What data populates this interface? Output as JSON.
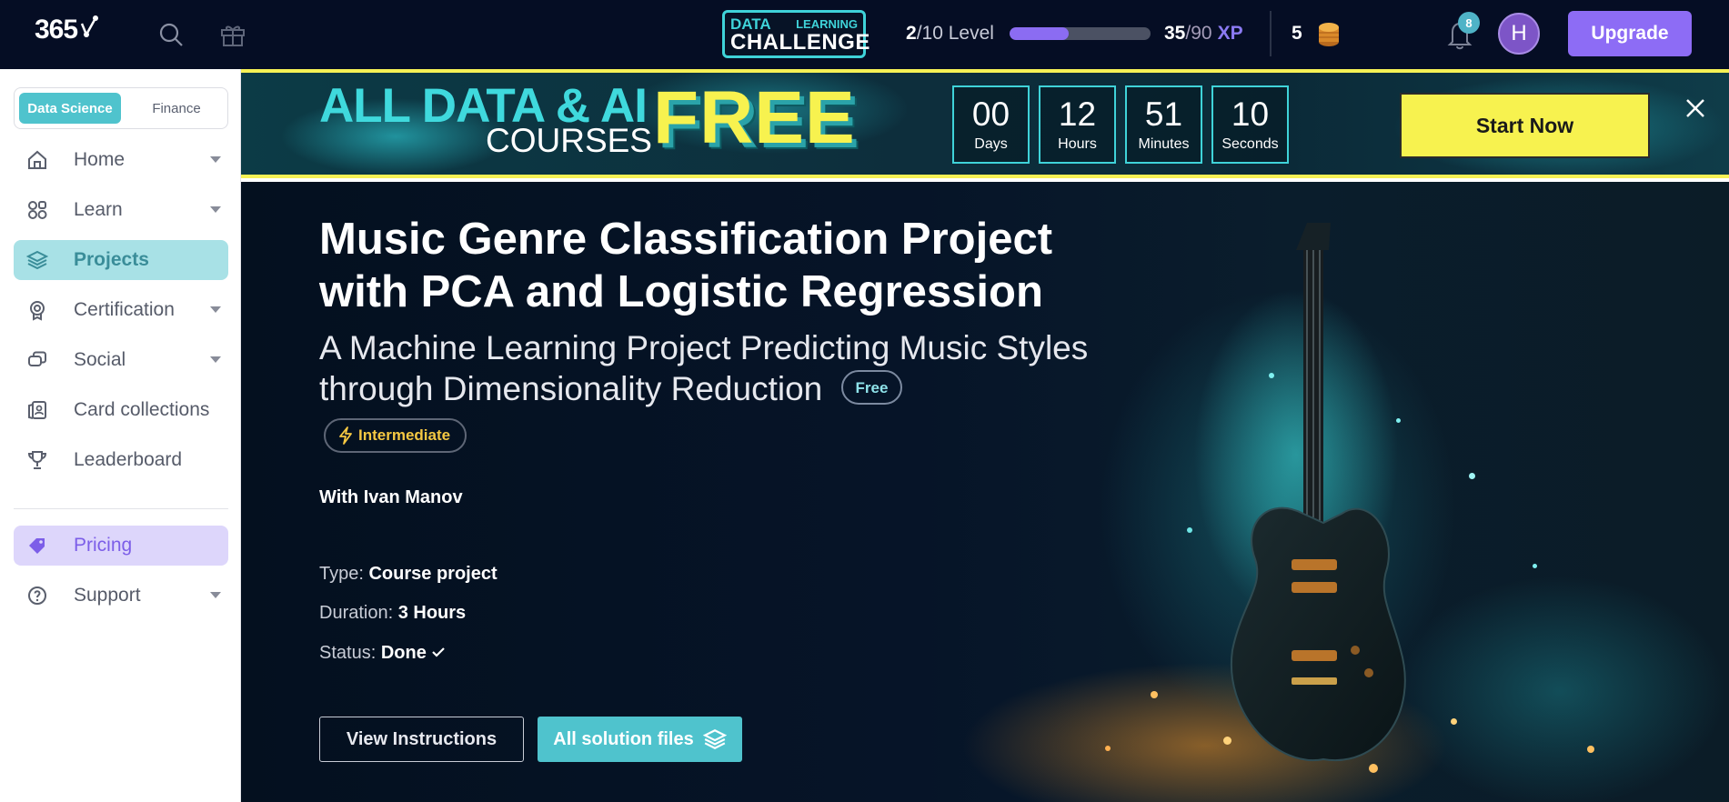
{
  "topbar": {
    "logo_text": "365",
    "challenge": {
      "line1_a": "DATA",
      "line1_b": "LEARNING",
      "line2": "CHALLENGE"
    },
    "level_current": "2",
    "level_total": "/10 Level",
    "level_progress": 0.42,
    "xp_current": "35",
    "xp_total": "/90",
    "xp_unit": "XP",
    "coins": "5",
    "notifications_count": "8",
    "avatar_initial": "H",
    "upgrade_label": "Upgrade"
  },
  "sidebar": {
    "tabs": [
      {
        "label": "Data Science",
        "active": true
      },
      {
        "label": "Finance",
        "active": false
      }
    ],
    "items": [
      {
        "label": "Home",
        "icon": "home-icon",
        "has_chevron": true
      },
      {
        "label": "Learn",
        "icon": "shapes-icon",
        "has_chevron": true
      },
      {
        "label": "Projects",
        "icon": "layers-icon",
        "has_chevron": false,
        "active": true
      },
      {
        "label": "Certification",
        "icon": "badge-icon",
        "has_chevron": true
      },
      {
        "label": "Social",
        "icon": "chat-icon",
        "has_chevron": true
      },
      {
        "label": "Card collections",
        "icon": "cards-icon",
        "has_chevron": false
      },
      {
        "label": "Leaderboard",
        "icon": "trophy-icon",
        "has_chevron": false
      },
      {
        "label": "Pricing",
        "icon": "tag-icon",
        "has_chevron": false
      },
      {
        "label": "Support",
        "icon": "help-icon",
        "has_chevron": true
      }
    ]
  },
  "banner": {
    "headline": "ALL DATA & AI",
    "subline": "COURSES",
    "highlight": "FREE",
    "countdown": [
      {
        "value": "00",
        "label": "Days"
      },
      {
        "value": "12",
        "label": "Hours"
      },
      {
        "value": "51",
        "label": "Minutes"
      },
      {
        "value": "10",
        "label": "Seconds"
      }
    ],
    "cta_label": "Start Now"
  },
  "project": {
    "title": "Music Genre Classification Project with PCA and Logistic Regression",
    "subtitle": "A Machine Learning Project Predicting Music Styles through Dimensionality Reduction",
    "price_badge": "Free",
    "level_badge": "Intermediate",
    "author": "With Ivan Manov",
    "type_label": "Type:",
    "type_value": "Course project",
    "duration_label": "Duration:",
    "duration_value": "3 Hours",
    "status_label": "Status:",
    "status_value": "Done",
    "view_instructions_label": "View Instructions",
    "solution_files_label": "All solution files"
  },
  "colors": {
    "topbar_bg": "#050d24",
    "accent_teal": "#4fc3cd",
    "accent_purple": "#8d6cf5",
    "banner_yellow": "#f7f24f",
    "level_badge_yellow": "#f5c842"
  }
}
